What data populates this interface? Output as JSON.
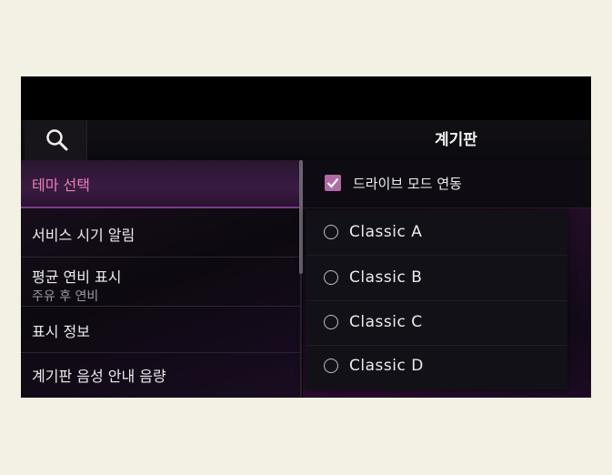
{
  "header": {
    "title": "계기판",
    "search_icon": "search-icon"
  },
  "menu": {
    "items": [
      {
        "label": "테마 선택",
        "active": true
      },
      {
        "label": "서비스 시기 알림"
      },
      {
        "label": "평균 연비 표시",
        "sublabel": "주유 후 연비"
      },
      {
        "label": "표시 정보"
      },
      {
        "label": "계기판 음성 안내 음량"
      }
    ]
  },
  "drive_mode": {
    "label": "드라이브 모드 연동",
    "checked": true
  },
  "theme_options": [
    {
      "label": "Classic A"
    },
    {
      "label": "Classic B"
    },
    {
      "label": "Classic C"
    },
    {
      "label": "Classic D"
    }
  ],
  "colors": {
    "accent": "#e77fb8",
    "checkbox": "#b06aa6",
    "background": "#000000"
  }
}
